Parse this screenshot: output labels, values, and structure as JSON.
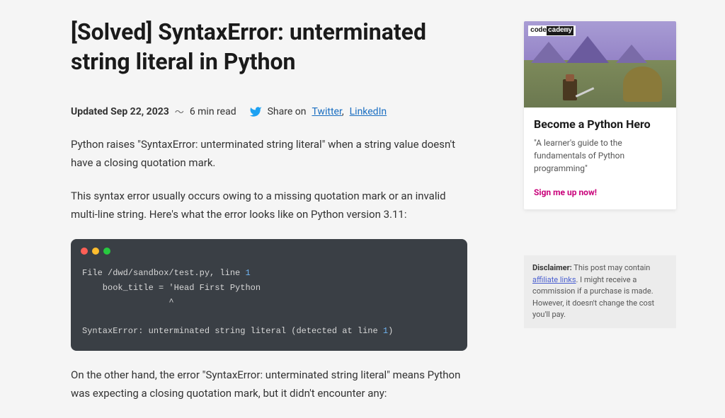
{
  "article": {
    "title": "[Solved] SyntaxError: unterminated string literal in Python",
    "updated_label": "Updated Sep 22, 2023",
    "read_time": "6 min read",
    "share_label": "Share on",
    "share_links": {
      "twitter": "Twitter",
      "linkedin": "LinkedIn"
    },
    "para1": "Python raises \"SyntaxError: unterminated string literal\" when a string value doesn't have a closing quotation mark.",
    "para2": "This syntax error usually occurs owing to a missing quotation mark or an invalid multi-line string. Here's what the error looks like on Python version 3.11:",
    "para3": "On the other hand, the error \"SyntaxError: unterminated string literal\" means Python was expecting a closing quotation mark, but it didn't encounter any:",
    "code": {
      "l1a": "File /dwd/sandbox/test.py, line ",
      "l1n": "1",
      "l2": "    book_title = 'Head First Python",
      "l3": "                 ^",
      "l4a": "SyntaxError: unterminated string literal (detected at line ",
      "l4n": "1",
      "l4b": ")"
    }
  },
  "ad": {
    "logo_left": "code",
    "logo_right": "cademy",
    "title": "Become a Python Hero",
    "desc": "\"A learner's guide to the fundamentals of Python programming\"",
    "cta": "Sign me up now!"
  },
  "disclaimer": {
    "label": "Disclaimer:",
    "text1": " This post may contain ",
    "link": "affiliate links",
    "text2": ". I might receive a commission if a purchase is made. However, it doesn't change the cost you'll pay."
  }
}
